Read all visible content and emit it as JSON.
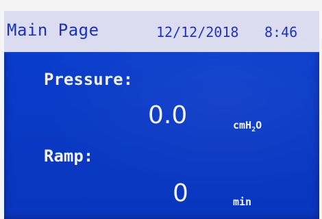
{
  "header": {
    "title": "Main Page",
    "date": "12/12/2018",
    "time": "8:46"
  },
  "pressure": {
    "label": "Pressure:",
    "value": "0.0",
    "unit_prefix": "cmH",
    "unit_subscript": "2",
    "unit_suffix": "O"
  },
  "ramp": {
    "label": "Ramp:",
    "value": "0",
    "unit": "min"
  },
  "colors": {
    "screen_background": "#0b3fd0",
    "title_bar_background": "#dcdcf0",
    "title_text": "#1630c8",
    "value_text": "#f4f4f4"
  }
}
